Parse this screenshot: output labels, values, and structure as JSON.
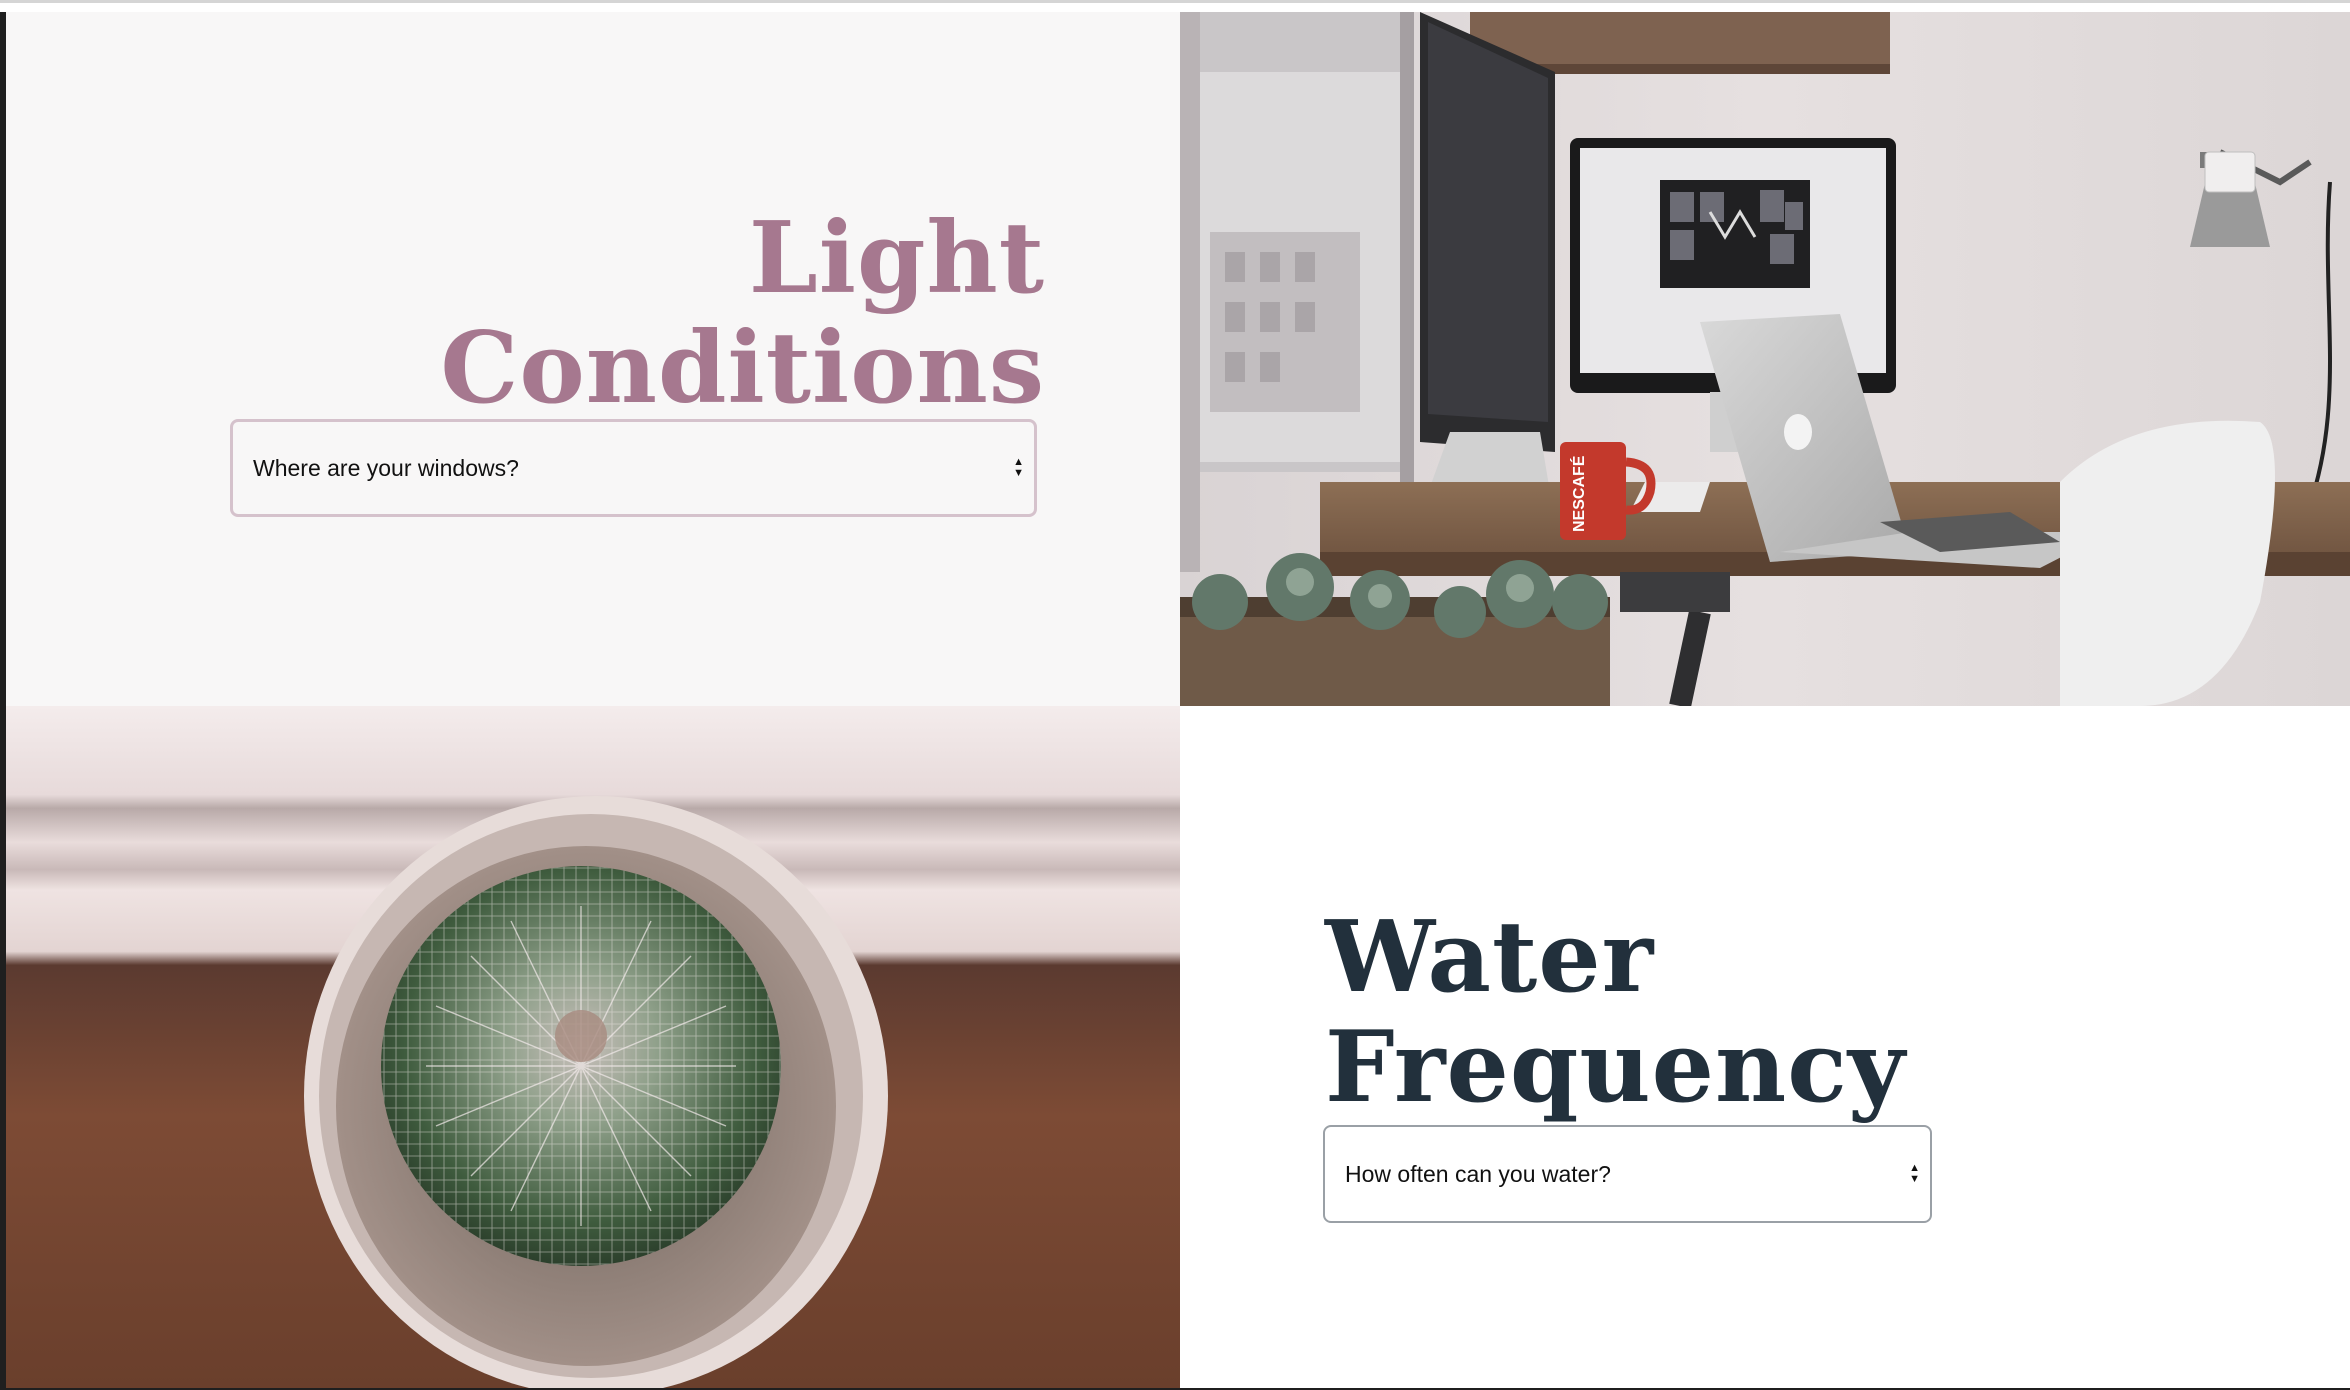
{
  "sections": {
    "light": {
      "heading_line1": "Light",
      "heading_line2": "Conditions",
      "select_value": "Where are your windows?"
    },
    "water": {
      "heading_line1": "Water",
      "heading_line2": "Frequency",
      "select_value": "How often can you water?"
    }
  },
  "photos": {
    "desk": {
      "mug_text": "NESCAFÉ"
    }
  },
  "icons": {
    "select_arrows": "up-down-caret-icon"
  },
  "colors": {
    "light_heading": "#a6788f",
    "water_heading": "#22303c",
    "light_bg": "#f8f7f7"
  }
}
